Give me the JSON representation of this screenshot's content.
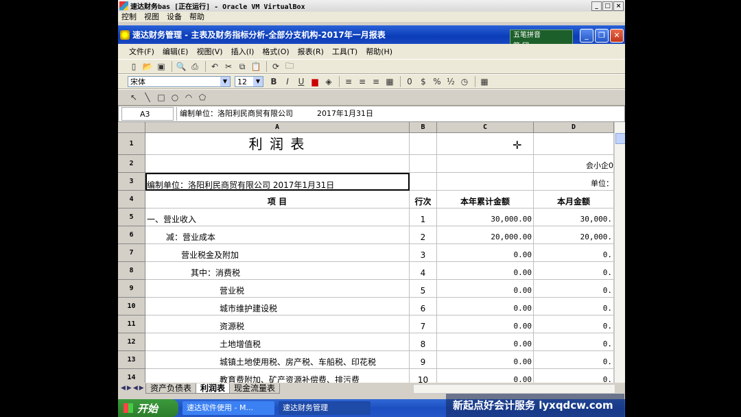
{
  "vbox": {
    "title": "速达财务bas [正在运行] - Oracle VM VirtualBox",
    "menu": [
      "控制",
      "视图",
      "设备",
      "帮助"
    ],
    "controls": [
      "_",
      "□",
      "×"
    ]
  },
  "app": {
    "title": "速达财务管理 - 主表及财务指标分析-全部分支机构-2017年一月报表",
    "menu": [
      "文件(F)",
      "编辑(E)",
      "视图(V)",
      "插入(I)",
      "格式(O)",
      "报表(R)",
      "工具(T)",
      "帮助(H)"
    ],
    "font_name": "宋体",
    "font_size": "12",
    "format_buttons": [
      "B",
      "I",
      "U"
    ],
    "ime": {
      "line1": "五笔拼音",
      "line2": "简 団"
    }
  },
  "formula_bar": {
    "name_box": "A3",
    "content": "编制单位：洛阳利民商贸有限公司          2017年1月31日"
  },
  "columns": [
    "A",
    "B",
    "C",
    "D"
  ],
  "rows": [
    {
      "n": "1",
      "a": "利      润      表",
      "b": "",
      "c": "",
      "d": ""
    },
    {
      "n": "2",
      "a": "",
      "b": "",
      "c": "",
      "d": "会小企0"
    },
    {
      "n": "3",
      "a": "编制单位：洛阳利民商贸有限公司          2017年1月31日",
      "b": "",
      "c": "",
      "d": "单位："
    },
    {
      "n": "4",
      "a": "项                    目",
      "b": "行次",
      "c": "本年累计金额",
      "d": "本月金额"
    },
    {
      "n": "5",
      "a": "一、营业收入",
      "b": "1",
      "c": "30,000.00",
      "d": "30,000."
    },
    {
      "n": "6",
      "a": "减：营业成本",
      "b": "2",
      "c": "20,000.00",
      "d": "20,000."
    },
    {
      "n": "7",
      "a": "营业税金及附加",
      "b": "3",
      "c": "0.00",
      "d": "0."
    },
    {
      "n": "8",
      "a": "其中：消费税",
      "b": "4",
      "c": "0.00",
      "d": "0."
    },
    {
      "n": "9",
      "a": "营业税",
      "b": "5",
      "c": "0.00",
      "d": "0."
    },
    {
      "n": "10",
      "a": "城市维护建设税",
      "b": "6",
      "c": "0.00",
      "d": "0."
    },
    {
      "n": "11",
      "a": "资源税",
      "b": "7",
      "c": "0.00",
      "d": "0."
    },
    {
      "n": "12",
      "a": "土地增值税",
      "b": "8",
      "c": "0.00",
      "d": "0."
    },
    {
      "n": "13",
      "a": "城镇土地使用税、房产税、车船税、印花税",
      "b": "9",
      "c": "0.00",
      "d": "0."
    },
    {
      "n": "14",
      "a": "教育费附加、矿产资源补偿费、排污费",
      "b": "10",
      "c": "0.00",
      "d": "0."
    }
  ],
  "sheet_tabs": [
    "资产负债表",
    "利润表",
    "现金流量表"
  ],
  "active_tab": "利润表",
  "taskbar": {
    "start": "开始",
    "tasks": [
      "速达软件使用 - M...",
      "速达财务管理"
    ]
  },
  "watermark": "新起点好会计服务 lyxqdcw.com"
}
